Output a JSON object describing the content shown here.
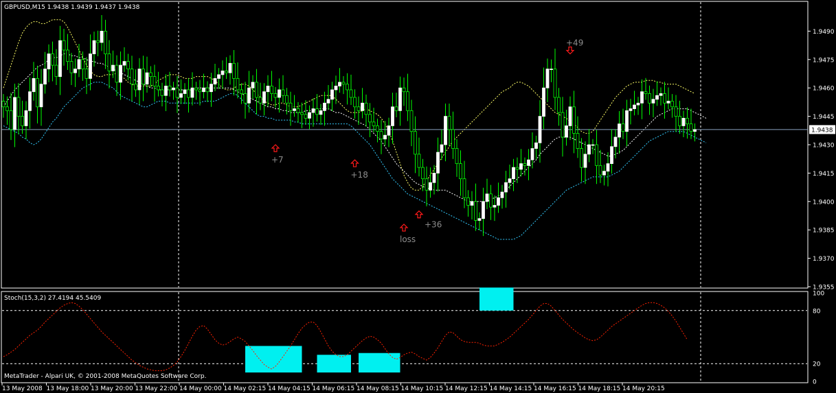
{
  "colors": {
    "background": "#000000",
    "frame": "#ffffff",
    "bull_candle": "#ffffff",
    "bear_candle": "#000000",
    "wick": "#00ff00",
    "band_upper": "#ffff66",
    "band_middle": "#ffffff",
    "band_lower": "#33ccff",
    "current_price_line": "#8aa2c0",
    "stoch_line": "#ff2200",
    "highlight_box": "#00f0f0",
    "arrow": "#ff1a1a",
    "annotation_text": "#8c8c8c"
  },
  "chart_data": [
    {
      "type": "candlestick",
      "title": "GBPUSD,M15  1.9438 1.9439 1.9437 1.9438",
      "current_price": 1.9438,
      "current_price_label": "1.9438",
      "ylim": [
        1.9355,
        1.9505
      ],
      "y_ticks": [
        "1.9490",
        "1.9475",
        "1.9460",
        "1.9445",
        "1.9430",
        "1.9415",
        "1.9400",
        "1.9385",
        "1.9370",
        "1.9355"
      ],
      "x_ticks": [
        "13 May 2008",
        "13 May 18:00",
        "13 May 20:00",
        "13 May 22:00",
        "14 May 00:00",
        "14 May 02:15",
        "14 May 04:15",
        "14 May 06:15",
        "14 May 08:15",
        "14 May 10:15",
        "14 May 12:15",
        "14 May 14:15",
        "14 May 16:15",
        "14 May 18:15",
        "14 May 20:15"
      ],
      "period_separators_at_bar": [
        40,
        157,
        157
      ],
      "closes": [
        1.945,
        1.9448,
        1.9438,
        1.9455,
        1.9445,
        1.944,
        1.9448,
        1.9458,
        1.9465,
        1.945,
        1.9462,
        1.947,
        1.9478,
        1.9472,
        1.9466,
        1.9485,
        1.948,
        1.9474,
        1.9468,
        1.947,
        1.9475,
        1.947,
        1.9465,
        1.9478,
        1.9485,
        1.9484,
        1.949,
        1.9478,
        1.9469,
        1.9472,
        1.9463,
        1.9472,
        1.9474,
        1.947,
        1.9462,
        1.9459,
        1.947,
        1.9462,
        1.9468,
        1.9466,
        1.9461,
        1.9459,
        1.9456,
        1.9461,
        1.9459,
        1.946,
        1.9455,
        1.9457,
        1.9459,
        1.9455,
        1.946,
        1.9459,
        1.9458,
        1.946,
        1.9458,
        1.9462,
        1.9465,
        1.9467,
        1.9469,
        1.9468,
        1.9473,
        1.9465,
        1.9459,
        1.9457,
        1.9452,
        1.946,
        1.9463,
        1.9455,
        1.9452,
        1.9458,
        1.9461,
        1.9457,
        1.9455,
        1.9459,
        1.9456,
        1.9452,
        1.9448,
        1.9449,
        1.9447,
        1.9446,
        1.9444,
        1.9447,
        1.9449,
        1.9446,
        1.9448,
        1.9452,
        1.9454,
        1.9459,
        1.9461,
        1.9463,
        1.9462,
        1.9459,
        1.9455,
        1.945,
        1.9448,
        1.9452,
        1.9446,
        1.9442,
        1.944,
        1.9437,
        1.9433,
        1.9435,
        1.944,
        1.945,
        1.9448,
        1.946,
        1.9458,
        1.9448,
        1.9437,
        1.9425,
        1.9418,
        1.9412,
        1.9406,
        1.941,
        1.9415,
        1.9426,
        1.943,
        1.9445,
        1.9438,
        1.9428,
        1.942,
        1.9412,
        1.9402,
        1.9398,
        1.94,
        1.939,
        1.9391,
        1.94,
        1.9404,
        1.9397,
        1.9398,
        1.9402,
        1.9405,
        1.941,
        1.9412,
        1.9418,
        1.9417,
        1.942,
        1.9419,
        1.9422,
        1.9428,
        1.9431,
        1.9445,
        1.946,
        1.947,
        1.947,
        1.9455,
        1.9447,
        1.9434,
        1.944,
        1.945,
        1.9436,
        1.9428,
        1.9418,
        1.9425,
        1.943,
        1.943,
        1.9419,
        1.9414,
        1.9416,
        1.942,
        1.9429,
        1.9434,
        1.9441,
        1.9437,
        1.9448,
        1.9449,
        1.9451,
        1.9452,
        1.9458,
        1.9457,
        1.9452,
        1.9454,
        1.9456,
        1.9457,
        1.9452,
        1.9453,
        1.945,
        1.9445,
        1.944,
        1.9444,
        1.9441,
        1.9437,
        1.9438
      ],
      "upper_band": [
        1.946,
        1.9466,
        1.9472,
        1.9478,
        1.9484,
        1.9489,
        1.9492,
        1.9494,
        1.9495,
        1.9495,
        1.9494,
        1.9494,
        1.9495,
        1.9496,
        1.9496,
        1.9496,
        1.9495,
        1.9492,
        1.9488,
        1.9484,
        1.948,
        1.9476,
        1.9472,
        1.9469,
        1.9467,
        1.9466,
        1.9466,
        1.9467,
        1.9467,
        1.9467,
        1.9468,
        1.9466,
        1.9465,
        1.9463,
        1.9462,
        1.9461,
        1.9461,
        1.9461,
        1.9461,
        1.9461,
        1.9462,
        1.9464,
        1.9465,
        1.9466,
        1.9467,
        1.9467,
        1.9467,
        1.9466,
        1.9465,
        1.9465,
        1.9465,
        1.9466,
        1.9466,
        1.9466,
        1.9466,
        1.9465,
        1.9464,
        1.9462,
        1.946,
        1.9459,
        1.9459,
        1.946,
        1.9461,
        1.9462,
        1.9462,
        1.9461,
        1.9459,
        1.9457,
        1.9455,
        1.9453,
        1.9452,
        1.9451,
        1.9451,
        1.9452,
        1.9452,
        1.9451,
        1.945,
        1.945,
        1.945,
        1.9451,
        1.9452,
        1.9453,
        1.9454,
        1.9455,
        1.9456,
        1.9456,
        1.9456,
        1.9456,
        1.9454,
        1.9452,
        1.945,
        1.9448,
        1.9447,
        1.9447,
        1.9447,
        1.9448,
        1.9449,
        1.9448,
        1.9447,
        1.9446,
        1.9444,
        1.9441,
        1.9437,
        1.9432,
        1.9426,
        1.942,
        1.9414,
        1.941,
        1.9407,
        1.9406,
        1.9406,
        1.9408,
        1.9411,
        1.9414,
        1.9417,
        1.942,
        1.9423,
        1.9426,
        1.9429,
        1.9432,
        1.9434,
        1.9436,
        1.9438,
        1.944,
        1.9442,
        1.9444,
        1.9446,
        1.9448,
        1.945,
        1.9452,
        1.9454,
        1.9456,
        1.9458,
        1.9459,
        1.946,
        1.9462,
        1.9463,
        1.9463,
        1.9462,
        1.9461,
        1.9459,
        1.9457,
        1.9455,
        1.9453,
        1.9451,
        1.9449,
        1.9447,
        1.9446,
        1.9445,
        1.9444,
        1.9442,
        1.9441,
        1.9439,
        1.9437,
        1.9436,
        1.9436,
        1.9437,
        1.944,
        1.9443,
        1.9446,
        1.9449,
        1.9452,
        1.9455,
        1.9457,
        1.9459,
        1.9461,
        1.9462,
        1.9463,
        1.9463,
        1.9463,
        1.9464,
        1.9464,
        1.9464,
        1.9463,
        1.9463,
        1.9462,
        1.9462,
        1.9462,
        1.9462,
        1.9461,
        1.946,
        1.9459,
        1.9458,
        1.9457
      ],
      "middle_band": [
        1.945,
        1.9453,
        1.9456,
        1.9459,
        1.9461,
        1.9463,
        1.9465,
        1.9467,
        1.9469,
        1.9471,
        1.9472,
        1.9473,
        1.9475,
        1.9476,
        1.9476,
        1.9477,
        1.9478,
        1.9478,
        1.9477,
        1.9477,
        1.9476,
        1.9476,
        1.9475,
        1.9474,
        1.9474,
        1.9473,
        1.9473,
        1.9472,
        1.9471,
        1.947,
        1.9469,
        1.9468,
        1.9467,
        1.9466,
        1.9465,
        1.9464,
        1.9463,
        1.9462,
        1.9461,
        1.946,
        1.946,
        1.9459,
        1.9459,
        1.9459,
        1.9459,
        1.9459,
        1.9459,
        1.9459,
        1.9459,
        1.9459,
        1.9459,
        1.946,
        1.946,
        1.946,
        1.946,
        1.946,
        1.946,
        1.946,
        1.946,
        1.946,
        1.946,
        1.9459,
        1.9458,
        1.9457,
        1.9456,
        1.9455,
        1.9454,
        1.9453,
        1.9452,
        1.9451,
        1.945,
        1.945,
        1.9449,
        1.9449,
        1.9448,
        1.9448,
        1.9447,
        1.9447,
        1.9447,
        1.9447,
        1.9448,
        1.9448,
        1.9448,
        1.9449,
        1.9449,
        1.9449,
        1.9449,
        1.9448,
        1.9447,
        1.9447,
        1.9446,
        1.9445,
        1.9444,
        1.9443,
        1.9442,
        1.9441,
        1.944,
        1.9438,
        1.9436,
        1.9434,
        1.9432,
        1.9429,
        1.9426,
        1.9423,
        1.942,
        1.9418,
        1.9416,
        1.9414,
        1.9412,
        1.941,
        1.9409,
        1.9408,
        1.9407,
        1.9407,
        1.9406,
        1.9406,
        1.9406,
        1.9406,
        1.9405,
        1.9404,
        1.9403,
        1.9402,
        1.9401,
        1.94,
        1.94,
        1.94,
        1.94,
        1.94,
        1.94,
        1.9401,
        1.9402,
        1.9403,
        1.9404,
        1.9406,
        1.9408,
        1.941,
        1.9412,
        1.9414,
        1.9416,
        1.9418,
        1.942,
        1.9422,
        1.9425,
        1.9427,
        1.9429,
        1.9431,
        1.9433,
        1.9434,
        1.9434,
        1.9434,
        1.9434,
        1.9433,
        1.9432,
        1.9431,
        1.943,
        1.9429,
        1.9428,
        1.9427,
        1.9426,
        1.9425,
        1.9424,
        1.9424,
        1.9425,
        1.9426,
        1.9427,
        1.9429,
        1.9431,
        1.9433,
        1.9435,
        1.9437,
        1.9439,
        1.9441,
        1.9443,
        1.9445,
        1.9446,
        1.9447,
        1.9448,
        1.9449,
        1.9449,
        1.9449,
        1.9449,
        1.9449,
        1.9448,
        1.9447,
        1.9446,
        1.9445,
        1.9444
      ],
      "lower_band": [
        1.944,
        1.9439,
        1.9438,
        1.9437,
        1.9436,
        1.9434,
        1.9433,
        1.9431,
        1.943,
        1.9431,
        1.9433,
        1.9436,
        1.9439,
        1.9442,
        1.9444,
        1.9447,
        1.945,
        1.9452,
        1.9454,
        1.9456,
        1.9458,
        1.946,
        1.9461,
        1.9462,
        1.9463,
        1.9463,
        1.9463,
        1.9462,
        1.9461,
        1.946,
        1.9458,
        1.9456,
        1.9455,
        1.9454,
        1.9453,
        1.9452,
        1.9451,
        1.945,
        1.945,
        1.9451,
        1.9452,
        1.9453,
        1.9453,
        1.9453,
        1.9452,
        1.9452,
        1.9452,
        1.9452,
        1.9452,
        1.9452,
        1.9452,
        1.9452,
        1.9452,
        1.9453,
        1.9453,
        1.9453,
        1.9453,
        1.9454,
        1.9455,
        1.9456,
        1.9457,
        1.9457,
        1.9456,
        1.9454,
        1.9452,
        1.945,
        1.9448,
        1.9446,
        1.9445,
        1.9445,
        1.9444,
        1.9444,
        1.9443,
        1.9443,
        1.9443,
        1.9443,
        1.9443,
        1.9442,
        1.9442,
        1.9441,
        1.9441,
        1.9441,
        1.9441,
        1.9441,
        1.9441,
        1.9441,
        1.9441,
        1.9441,
        1.9441,
        1.9441,
        1.9441,
        1.9441,
        1.944,
        1.9438,
        1.9436,
        1.9434,
        1.9432,
        1.943,
        1.9427,
        1.9424,
        1.9421,
        1.9418,
        1.9415,
        1.9412,
        1.941,
        1.9408,
        1.9406,
        1.9404,
        1.9403,
        1.9402,
        1.9401,
        1.94,
        1.9399,
        1.9398,
        1.9397,
        1.9396,
        1.9395,
        1.9394,
        1.9393,
        1.9392,
        1.9391,
        1.939,
        1.9389,
        1.9388,
        1.9387,
        1.9386,
        1.9385,
        1.9384,
        1.9383,
        1.9382,
        1.9381,
        1.938,
        1.938,
        1.938,
        1.938,
        1.938,
        1.9381,
        1.9382,
        1.9384,
        1.9386,
        1.9388,
        1.939,
        1.9392,
        1.9394,
        1.9396,
        1.9398,
        1.94,
        1.9402,
        1.9404,
        1.9406,
        1.9407,
        1.9408,
        1.9409,
        1.941,
        1.9411,
        1.9412,
        1.9413,
        1.9413,
        1.9413,
        1.9413,
        1.9413,
        1.9414,
        1.9415,
        1.9416,
        1.9418,
        1.942,
        1.9422,
        1.9424,
        1.9426,
        1.9428,
        1.943,
        1.9432,
        1.9433,
        1.9434,
        1.9435,
        1.9436,
        1.9437,
        1.9437,
        1.9437,
        1.9437,
        1.9437,
        1.9436,
        1.9435,
        1.9434,
        1.9433,
        1.9432,
        1.9431
      ],
      "signals": [
        {
          "type": "buy",
          "bar": 72,
          "price": 1.943,
          "label": "+7"
        },
        {
          "type": "buy",
          "bar": 93,
          "price": 1.9422,
          "label": "+18"
        },
        {
          "type": "buy",
          "bar": 106,
          "price": 1.9388,
          "label": "loss"
        },
        {
          "type": "buy",
          "bar": 110,
          "price": 1.9395,
          "label": "+36"
        },
        {
          "type": "sell",
          "bar": 150,
          "price": 1.9478,
          "label": "+49"
        }
      ]
    },
    {
      "type": "line",
      "title": "Stoch(15,3,2) 27.4194 45.5409",
      "ylim": [
        0,
        100
      ],
      "y_ticks": [
        "100",
        "80",
        "20",
        "0"
      ],
      "levels": [
        80,
        20
      ],
      "series": [
        {
          "values": [
            28,
            30,
            33,
            36,
            40,
            44,
            48,
            52,
            55,
            58,
            62,
            67,
            71,
            75,
            79,
            83,
            86,
            88,
            89,
            88,
            85,
            81,
            76,
            71,
            66,
            61,
            56,
            52,
            48,
            44,
            40,
            36,
            32,
            28,
            24,
            21,
            18,
            16,
            14,
            13,
            12,
            12,
            12,
            13,
            15,
            18,
            22,
            28,
            35,
            43,
            51,
            58,
            62,
            63,
            59,
            53,
            47,
            43,
            41,
            42,
            45,
            48,
            50,
            48,
            45,
            40,
            35,
            29,
            24,
            19,
            16,
            14,
            17,
            22,
            28,
            34,
            40,
            47,
            54,
            60,
            64,
            67,
            67,
            63,
            56,
            48,
            40,
            34,
            30,
            28,
            28,
            30,
            34,
            38,
            42,
            46,
            49,
            51,
            50,
            47,
            43,
            37,
            31,
            27,
            25,
            27,
            30,
            32,
            33,
            31,
            28,
            26,
            24,
            27,
            32,
            38,
            45,
            52,
            56,
            55,
            51,
            47,
            45,
            44,
            44,
            44,
            43,
            41,
            40,
            40,
            40,
            42,
            44,
            47,
            50,
            54,
            58,
            62,
            66,
            70,
            75,
            80,
            85,
            88,
            88,
            85,
            80,
            75,
            70,
            66,
            62,
            58,
            55,
            52,
            49,
            47,
            46,
            47,
            50,
            54,
            58,
            62,
            65,
            68,
            71,
            74,
            77,
            80,
            83,
            86,
            88,
            89,
            89,
            88,
            86,
            83,
            79,
            74,
            68,
            61,
            54,
            47
          ]
        }
      ]
    }
  ],
  "highlight_boxes": [
    {
      "bar_from": 64,
      "bar_to": 79,
      "y_from": 10,
      "y_to": 40
    },
    {
      "bar_from": 83,
      "bar_to": 92,
      "y_from": 10,
      "y_to": 30
    },
    {
      "bar_from": 94,
      "bar_to": 105,
      "y_from": 10,
      "y_to": 32
    },
    {
      "bar_from": 126,
      "bar_to": 135,
      "y_from": 80,
      "y_to": 106
    }
  ],
  "copyright": "MetaTrader - Alpari UK, © 2001-2008 MetaQuotes Software Corp."
}
